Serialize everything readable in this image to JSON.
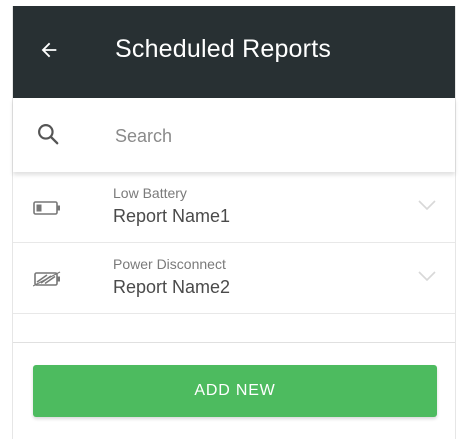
{
  "header": {
    "title": "Scheduled Reports",
    "back_icon": "arrow-left-icon"
  },
  "search": {
    "placeholder": "Search",
    "icon": "search-icon"
  },
  "reports": [
    {
      "type": "Low Battery",
      "name": "Report Name1",
      "icon": "battery-low-icon"
    },
    {
      "type": "Power Disconnect",
      "name": "Report Name2",
      "icon": "power-disconnect-icon"
    }
  ],
  "footer": {
    "add_label": "ADD NEW"
  },
  "colors": {
    "appbar": "#283033",
    "accent": "#4dbb5f"
  }
}
